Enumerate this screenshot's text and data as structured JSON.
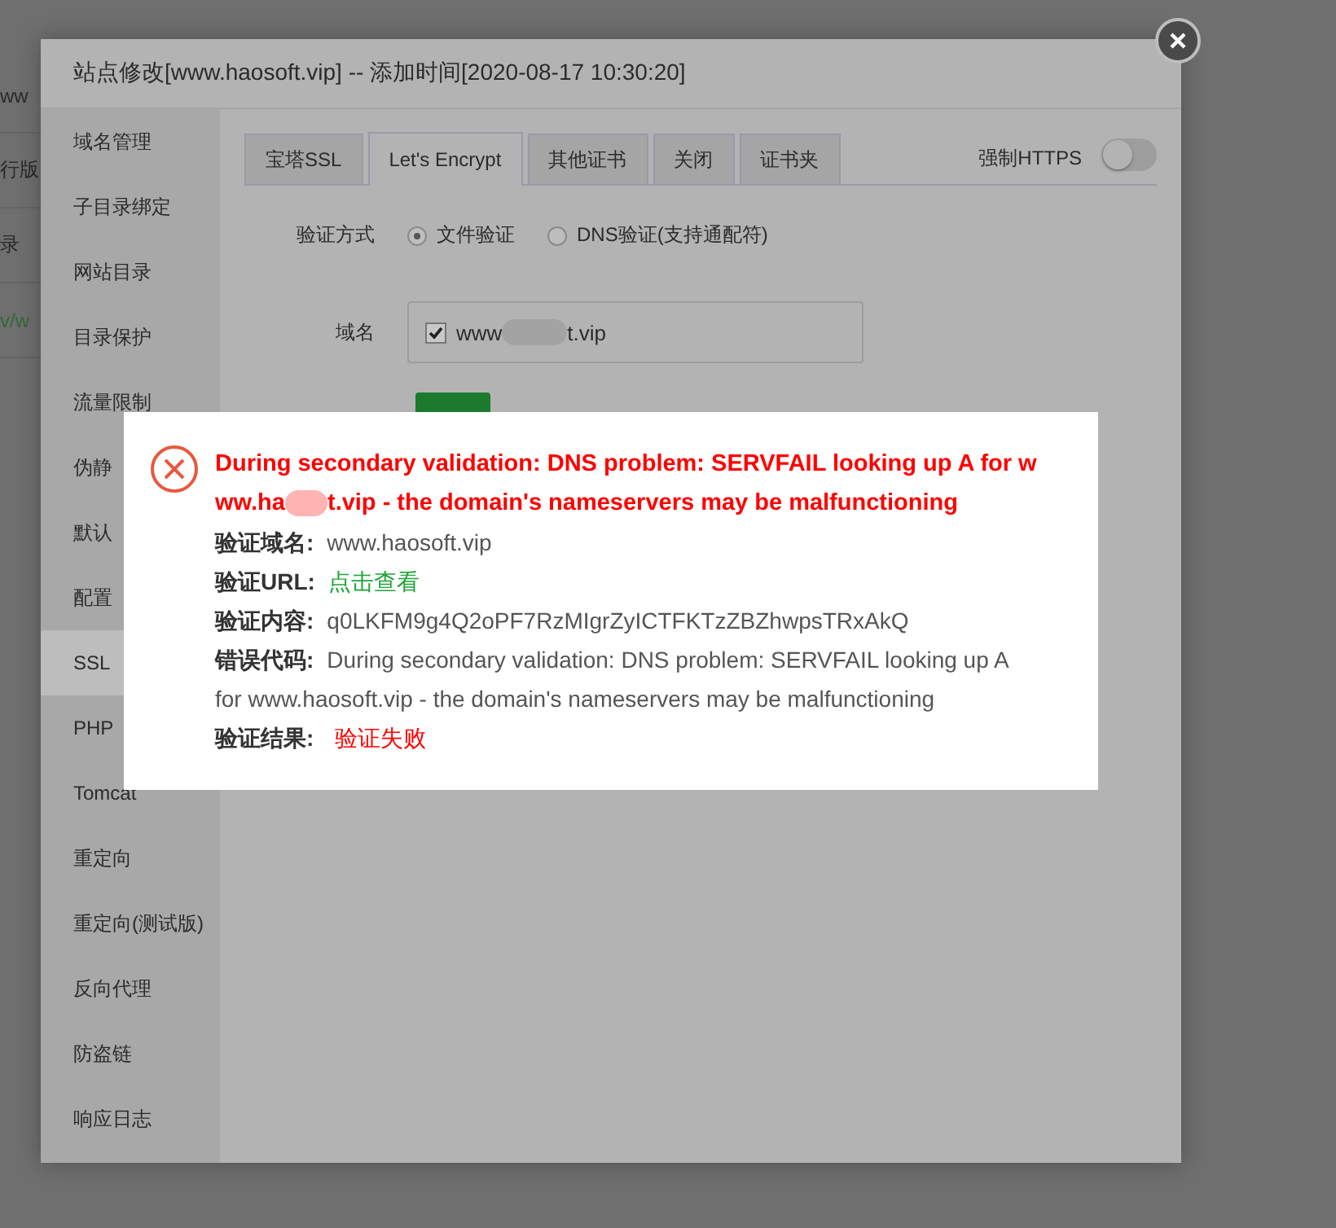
{
  "background_page": {
    "fragments": [
      {
        "text": "ww",
        "kind": "plain"
      },
      {
        "text": "行版",
        "kind": "plain"
      },
      {
        "text": "录",
        "kind": "plain"
      },
      {
        "text": "v/w",
        "kind": "link"
      }
    ]
  },
  "dialog": {
    "title": "站点修改[www.haosoft.vip] -- 添加时间[2020-08-17 10:30:20]",
    "sidebar": {
      "items": [
        {
          "label": "域名管理",
          "selected": false
        },
        {
          "label": "子目录绑定",
          "selected": false
        },
        {
          "label": "网站目录",
          "selected": false
        },
        {
          "label": "目录保护",
          "selected": false
        },
        {
          "label": "流量限制",
          "selected": false
        },
        {
          "label": "伪静",
          "selected": false
        },
        {
          "label": "默认",
          "selected": false
        },
        {
          "label": "配置",
          "selected": false
        },
        {
          "label": "SSL",
          "selected": true
        },
        {
          "label": "PHP",
          "selected": false
        },
        {
          "label": "Tomcat",
          "selected": false
        },
        {
          "label": "重定向",
          "selected": false
        },
        {
          "label": "重定向(测试版)",
          "selected": false
        },
        {
          "label": "反向代理",
          "selected": false
        },
        {
          "label": "防盗链",
          "selected": false
        },
        {
          "label": "响应日志",
          "selected": false
        }
      ]
    },
    "tabs": [
      {
        "label": "宝塔SSL",
        "selected": false
      },
      {
        "label": "Let's Encrypt",
        "selected": true
      },
      {
        "label": "其他证书",
        "selected": false
      },
      {
        "label": "关闭",
        "selected": false
      },
      {
        "label": "证书夹",
        "selected": false
      }
    ],
    "force_https": {
      "label": "强制HTTPS",
      "on": false
    },
    "verify_method": {
      "label": "验证方式",
      "options": [
        {
          "label": "文件验证",
          "selected": true
        },
        {
          "label": "DNS验证(支持通配符)",
          "selected": false
        }
      ]
    },
    "domains": {
      "label": "域名",
      "items": [
        {
          "checked": true,
          "text_start": "www",
          "text_end": "t.vip"
        }
      ]
    }
  },
  "error_popup": {
    "title_line_1": "During secondary validation: DNS problem: SERVFAIL looking up A for w",
    "title_line_2_start": "ww.ha",
    "title_line_2_end": "t.vip - the domain's nameservers may be malfunctioning",
    "rows": [
      {
        "label": "验证域名:",
        "value": "www.haosoft.vip",
        "kind": "plain"
      },
      {
        "label": "验证URL:",
        "value": "点击查看",
        "kind": "link"
      },
      {
        "label": "验证内容:",
        "value": "q0LKFM9g4Q2oPF7RzMIgrZyICTFKTzZBZhwpsTRxAkQ",
        "kind": "plain"
      },
      {
        "label": "错误代码:",
        "value": "During secondary validation: DNS problem: SERVFAIL looking up A for www.haosoft.vip - the domain's nameservers may be malfunctioning",
        "kind": "plain"
      },
      {
        "label": "验证结果:",
        "value": "验证失败",
        "kind": "error"
      }
    ]
  }
}
